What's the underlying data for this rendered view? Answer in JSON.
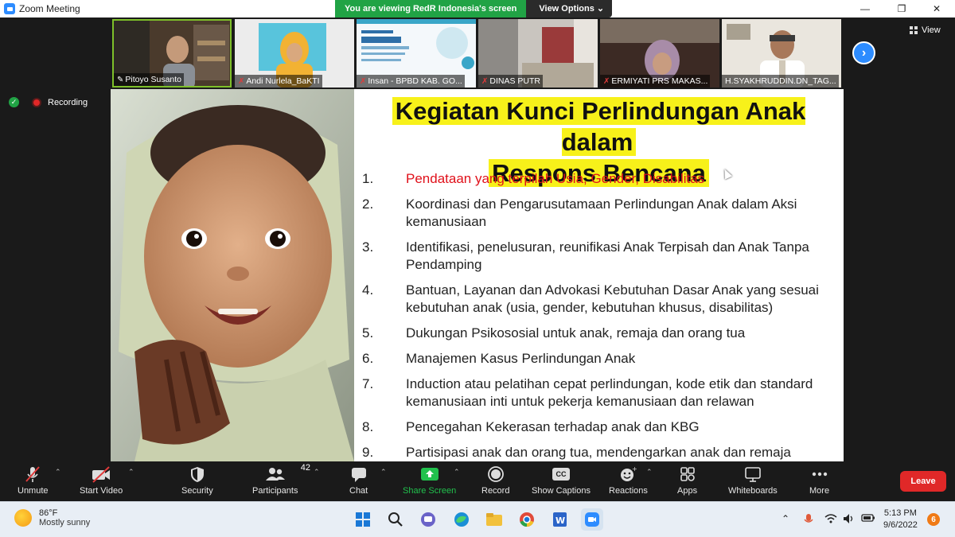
{
  "window": {
    "title": "Zoom Meeting",
    "minimize": "—",
    "restore": "❐",
    "close": "✕"
  },
  "banner": {
    "viewing_text": "You are viewing RedR Indonesia's screen",
    "view_options_label": "View Options ⌄"
  },
  "participants": [
    {
      "name": "Pitoyo Susanto",
      "muted": false,
      "pinned": true,
      "active": true
    },
    {
      "name": "Andi Nurlela_BaKTI",
      "muted": true
    },
    {
      "name": "Insan - BPBD KAB. GO...",
      "muted": true
    },
    {
      "name": "DINAS PUTR",
      "muted": true
    },
    {
      "name": "ERMIYATI PRS MAKAS...",
      "muted": true
    },
    {
      "name": "H.SYAKHRUDDIN.DN_TAG...",
      "muted": false
    }
  ],
  "strip_controls": {
    "next": "›",
    "view_label": "View"
  },
  "recording": {
    "label": "Recording"
  },
  "slide": {
    "title_line1": "Kegiatan Kunci Perlindungan Anak dalam",
    "title_line2": "Respons Bencana",
    "items": [
      {
        "num": "1.",
        "text": "Pendataan yang terpilah Usia, Gender, Disabilitas"
      },
      {
        "num": "2.",
        "text": "Koordinasi dan Pengarusutamaan Perlindungan Anak dalam Aksi kemanusiaan"
      },
      {
        "num": "3.",
        "text": "Identifikasi, penelusuran, reunifikasi Anak Terpisah dan Anak Tanpa Pendamping"
      },
      {
        "num": "4.",
        "text": "Bantuan, Layanan dan Advokasi Kebutuhan Dasar Anak yang sesuai kebutuhan anak (usia, gender, kebutuhan khusus, disabilitas)"
      },
      {
        "num": "5.",
        "text": "Dukungan Psikososial untuk anak, remaja dan orang tua"
      },
      {
        "num": "6.",
        "text": "Manajemen Kasus Perlindungan Anak"
      },
      {
        "num": "7.",
        "text": "Induction atau pelatihan cepat perlindungan, kode etik dan standard kemanusiaan inti untuk pekerja kemanusiaan dan relawan"
      },
      {
        "num": "8.",
        "text": "Pencegahan Kekerasan terhadap anak dan KBG"
      },
      {
        "num": "9.",
        "text": "Partisipasi anak dan orang tua, mendengarkan anak dan remaja"
      }
    ]
  },
  "toolbar": {
    "unmute": "Unmute",
    "start_video": "Start Video",
    "security": "Security",
    "participants": "Participants",
    "participants_count": "42",
    "chat": "Chat",
    "share_screen": "Share Screen",
    "record": "Record",
    "show_captions": "Show Captions",
    "captions_icon": "CC",
    "reactions": "Reactions",
    "apps": "Apps",
    "whiteboards": "Whiteboards",
    "more": "More",
    "leave": "Leave"
  },
  "taskbar": {
    "temperature": "86°F",
    "condition": "Mostly sunny",
    "time": "5:13 PM",
    "date": "9/6/2022",
    "notifications": "6"
  },
  "colors": {
    "zoom_blue": "#2d8cff",
    "banner_green": "#21a345",
    "leave_red": "#e02828",
    "slide_highlight": "#f7f11a",
    "item_red": "#e0101a"
  }
}
